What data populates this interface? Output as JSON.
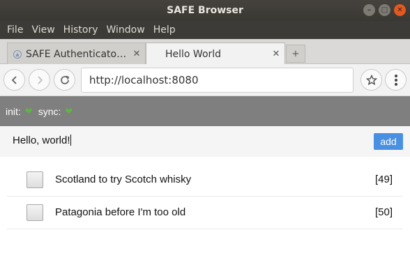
{
  "window": {
    "title": "SAFE Browser",
    "controls": [
      "minimize-icon",
      "maximize-icon",
      "close-icon"
    ]
  },
  "menu": [
    "File",
    "View",
    "History",
    "Window",
    "Help"
  ],
  "tabs": [
    {
      "title": "SAFE Authenticator ...",
      "favicon": "safe-logo-icon",
      "active": false
    },
    {
      "title": "Hello World",
      "active": true
    }
  ],
  "new_tab_label": "+",
  "address": {
    "url": "http://localhost:8080"
  },
  "status": {
    "init_label": "init:",
    "sync_label": "sync:",
    "indicator": "green-heart-icon"
  },
  "todo_input": {
    "value": "Hello, world!",
    "add_label": "add"
  },
  "todos": [
    {
      "text": "Scotland to try Scotch whisky",
      "id_label": "[49]",
      "checked": false
    },
    {
      "text": "Patagonia before I'm too old",
      "id_label": "[50]",
      "checked": false
    }
  ],
  "colors": {
    "accent": "#4a90e2",
    "statusbar": "#7f7f7f",
    "heart": "#5cb83c"
  }
}
